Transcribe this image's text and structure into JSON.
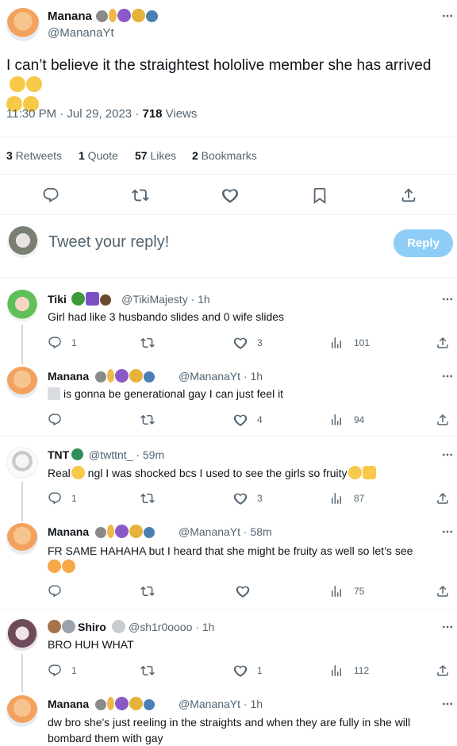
{
  "main_tweet": {
    "name": "Manana",
    "handle": "@MananaYt",
    "text": "I can’t believe it the straightest hololive member she has arrived",
    "time": "11:30 PM · Jul 29, 2023 · ",
    "views_count": "718",
    "views_label": " Views",
    "stats": [
      {
        "count": "3",
        "label": " Retweets"
      },
      {
        "count": "1",
        "label": " Quote"
      },
      {
        "count": "57",
        "label": " Likes"
      },
      {
        "count": "2",
        "label": " Bookmarks"
      }
    ]
  },
  "reply_box": {
    "placeholder": "Tweet your reply!",
    "button": "Reply"
  },
  "replies": [
    {
      "name": "Tiki",
      "handle": "@TikiMajesty · 1h",
      "text": "Girl had like 3 husbando slides and 0 wife slides",
      "reply_count": "1",
      "retweet_count": "",
      "like_count": "3",
      "view_count": "101"
    },
    {
      "name": "Manana",
      "handle": "@MananaYt · 1h",
      "text": "is gonna be generational gay I can just feel it",
      "reply_count": "",
      "retweet_count": "",
      "like_count": "4",
      "view_count": "94"
    },
    {
      "name": "TNT",
      "handle": "@twttnt_ · 59m",
      "text": "Real",
      "text2": " ngl I was shocked bcs I used to see the girls so fruity",
      "reply_count": "1",
      "retweet_count": "",
      "like_count": "3",
      "view_count": "87"
    },
    {
      "name": "Manana",
      "handle": "@MananaYt · 58m",
      "text": "FR SAME HAHAHA but I heard that she might be fruity as well so let’s see",
      "reply_count": "",
      "retweet_count": "",
      "like_count": "",
      "view_count": "75"
    },
    {
      "name": "Shiro",
      "handle": "@sh1r0oooo · 1h",
      "text": "BRO HUH WHAT",
      "reply_count": "1",
      "retweet_count": "",
      "like_count": "1",
      "view_count": "112"
    },
    {
      "name": "Manana",
      "handle": "@MananaYt · 1h",
      "text": "dw bro she's just reeling in the straights and when they are fully in she will bombard them with gay"
    }
  ],
  "icons": {
    "reply": "reply-icon",
    "retweet": "retweet-icon",
    "like": "heart-icon",
    "bookmark": "bookmark-icon",
    "share": "share-icon",
    "views": "views-icon",
    "more": "more-icon"
  },
  "colors": {
    "accent": "#1d9bf0",
    "reply_button": "#8ecdf8",
    "muted": "#536471",
    "divider": "#eff3f4"
  }
}
